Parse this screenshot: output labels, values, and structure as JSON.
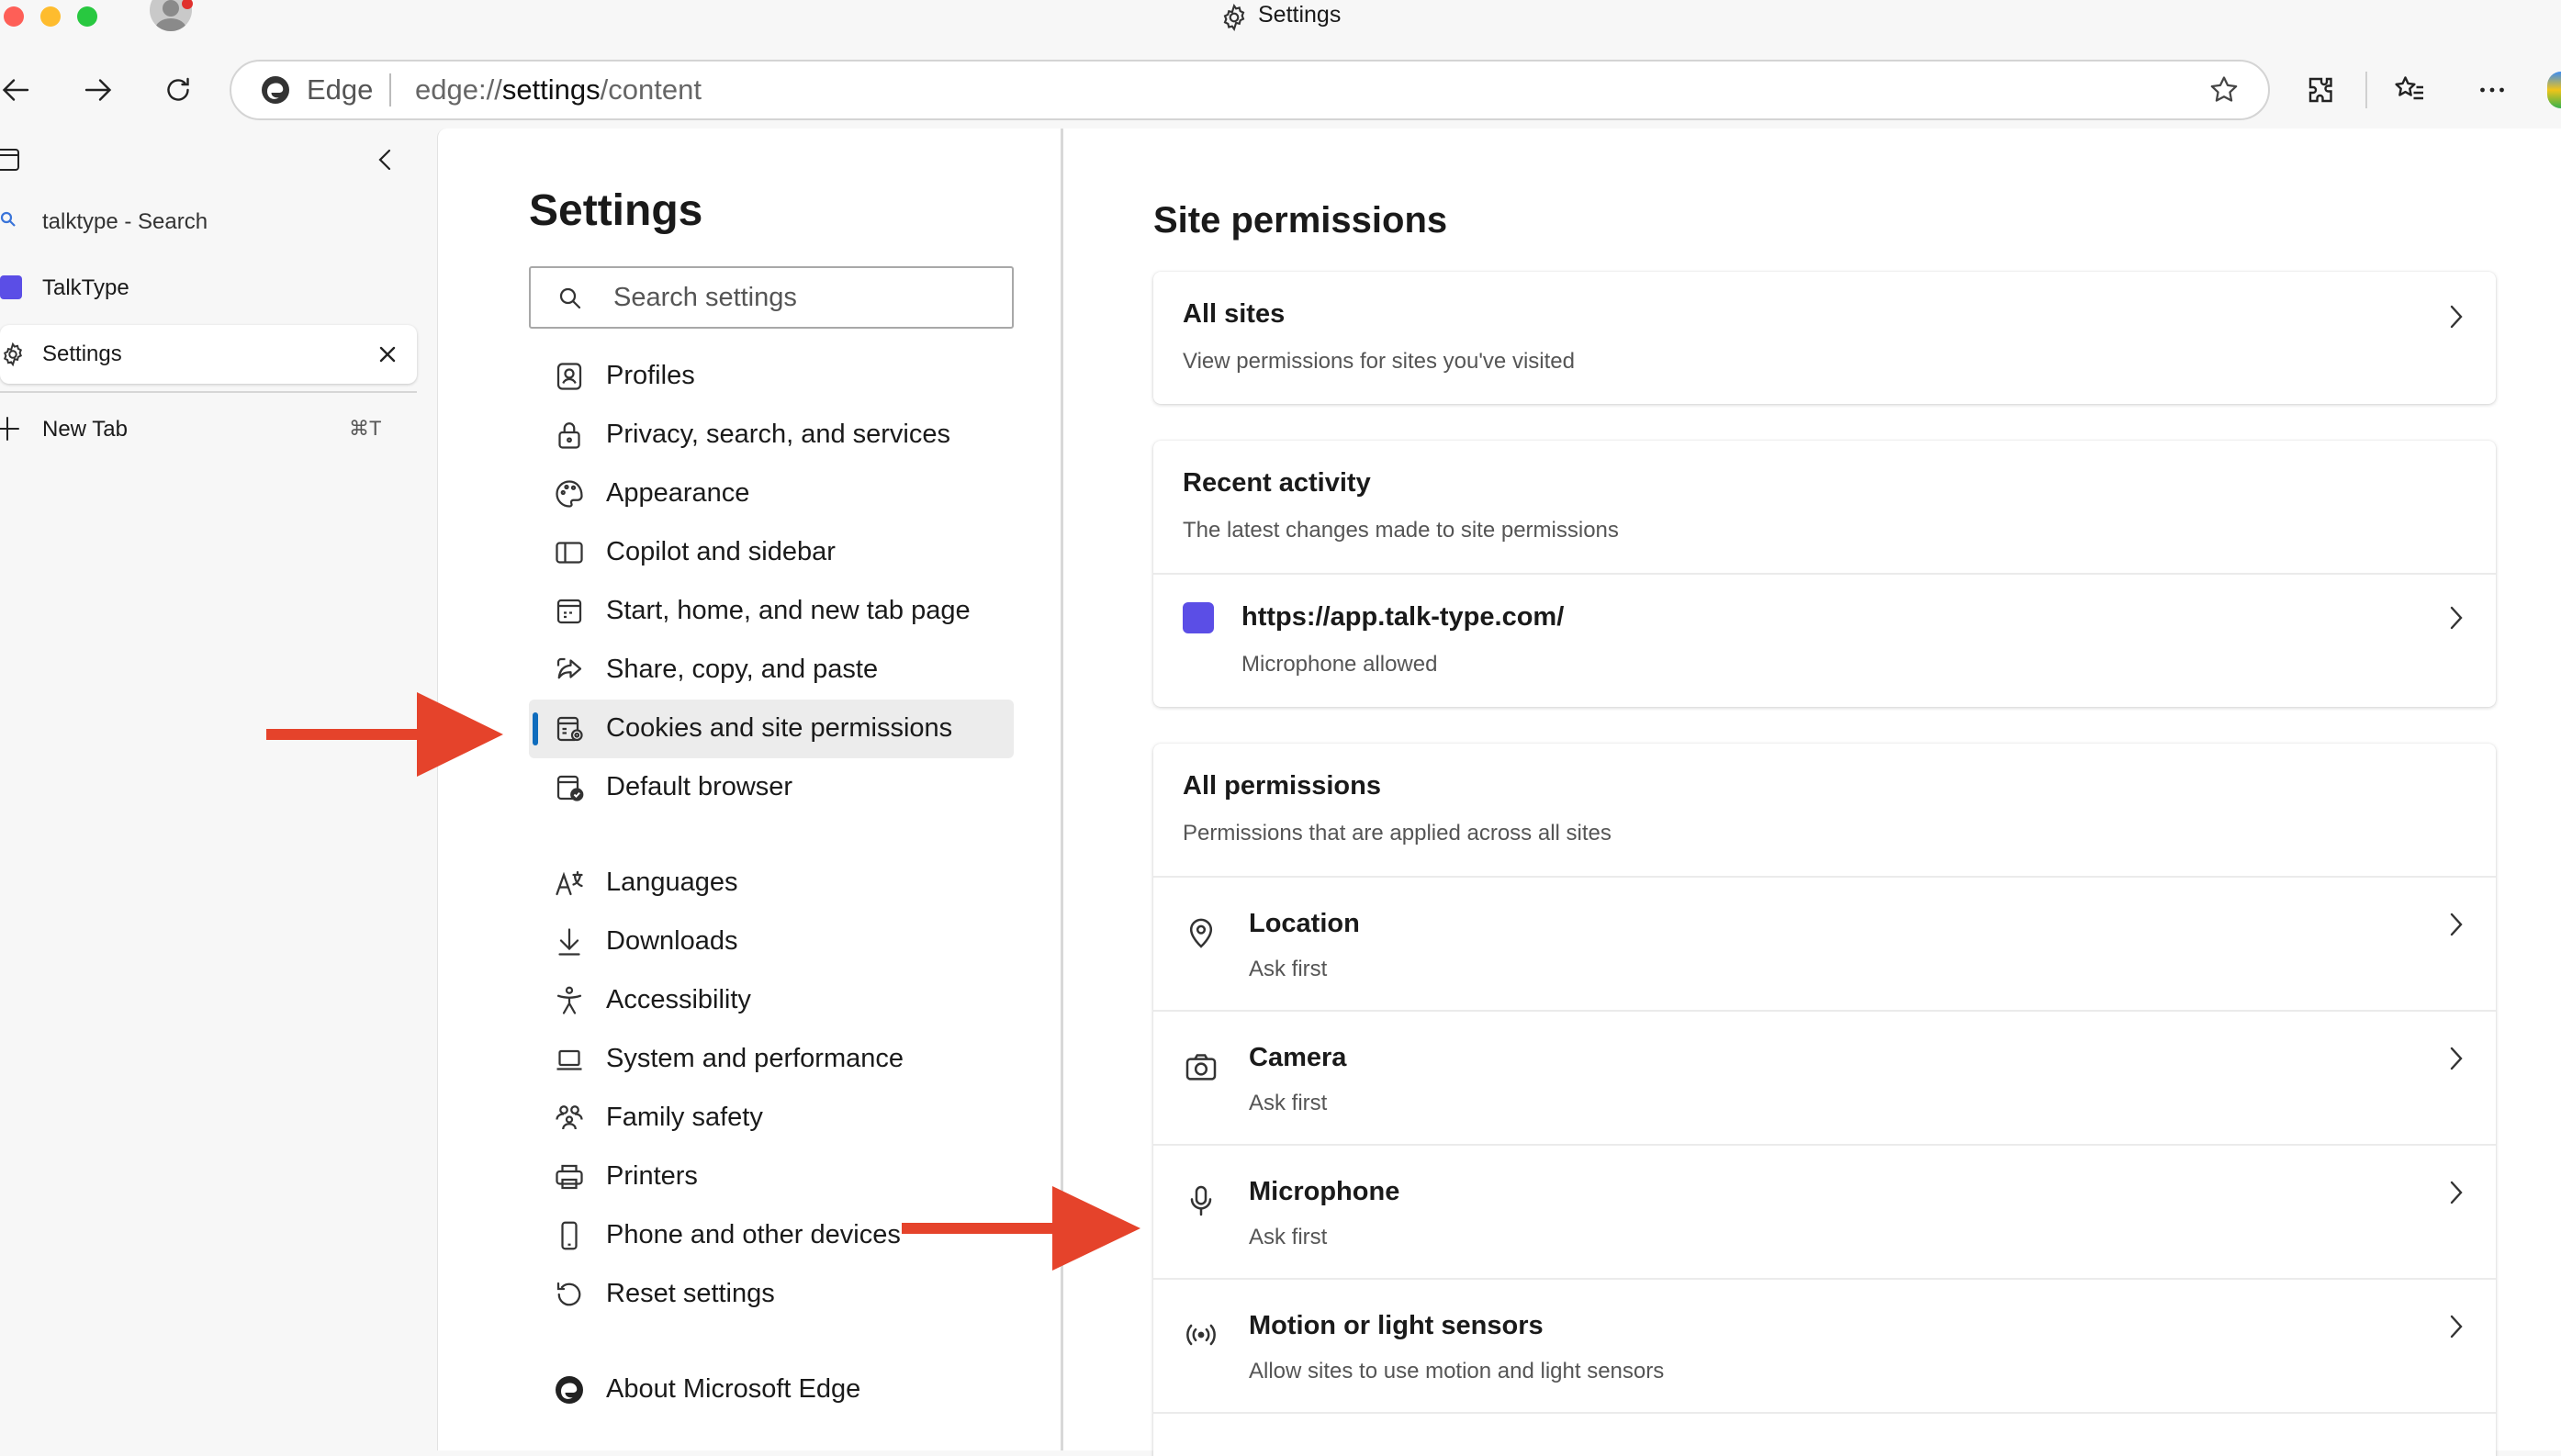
{
  "window": {
    "title": "Settings"
  },
  "address_bar": {
    "brand": "Edge",
    "url_prefix": "edge://",
    "url_bold": "settings",
    "url_suffix": "/content"
  },
  "tabs": [
    {
      "label": "talktype - Search"
    },
    {
      "label": "TalkType"
    },
    {
      "label": "Settings"
    }
  ],
  "new_tab": {
    "label": "New Tab",
    "shortcut": "⌘T"
  },
  "settings": {
    "title": "Settings",
    "search_placeholder": "Search settings",
    "nav": [
      {
        "label": "Profiles",
        "icon": "profile-icon"
      },
      {
        "label": "Privacy, search, and services",
        "icon": "lock-icon"
      },
      {
        "label": "Appearance",
        "icon": "palette-icon"
      },
      {
        "label": "Copilot and sidebar",
        "icon": "sidebar-icon"
      },
      {
        "label": "Start, home, and new tab page",
        "icon": "home-page-icon"
      },
      {
        "label": "Share, copy, and paste",
        "icon": "share-icon"
      },
      {
        "label": "Cookies and site permissions",
        "icon": "cookies-icon"
      },
      {
        "label": "Default browser",
        "icon": "default-browser-icon"
      },
      {
        "label": "Languages",
        "icon": "languages-icon"
      },
      {
        "label": "Downloads",
        "icon": "download-icon"
      },
      {
        "label": "Accessibility",
        "icon": "accessibility-icon"
      },
      {
        "label": "System and performance",
        "icon": "laptop-icon"
      },
      {
        "label": "Family safety",
        "icon": "family-icon"
      },
      {
        "label": "Printers",
        "icon": "printer-icon"
      },
      {
        "label": "Phone and other devices",
        "icon": "phone-icon"
      },
      {
        "label": "Reset settings",
        "icon": "reset-icon"
      },
      {
        "label": "About Microsoft Edge",
        "icon": "edge-logo-icon"
      }
    ]
  },
  "site_permissions": {
    "title": "Site permissions",
    "all_sites": {
      "title": "All sites",
      "subtitle": "View permissions for sites you've visited"
    },
    "recent_activity": {
      "title": "Recent activity",
      "subtitle": "The latest changes made to site permissions",
      "site": {
        "url": "https://app.talk-type.com/",
        "status": "Microphone allowed"
      }
    },
    "all_permissions": {
      "title": "All permissions",
      "subtitle": "Permissions that are applied across all sites",
      "items": [
        {
          "title": "Location",
          "status": "Ask first",
          "icon": "location-icon"
        },
        {
          "title": "Camera",
          "status": "Ask first",
          "icon": "camera-icon"
        },
        {
          "title": "Microphone",
          "status": "Ask first",
          "icon": "microphone-icon"
        },
        {
          "title": "Motion or light sensors",
          "status": "Allow sites to use motion and light sensors",
          "icon": "sensors-icon"
        }
      ]
    }
  },
  "colors": {
    "accent": "#0f6cbd",
    "annotation_arrow": "#e5432b",
    "app_icon": "#5b4ee6"
  }
}
